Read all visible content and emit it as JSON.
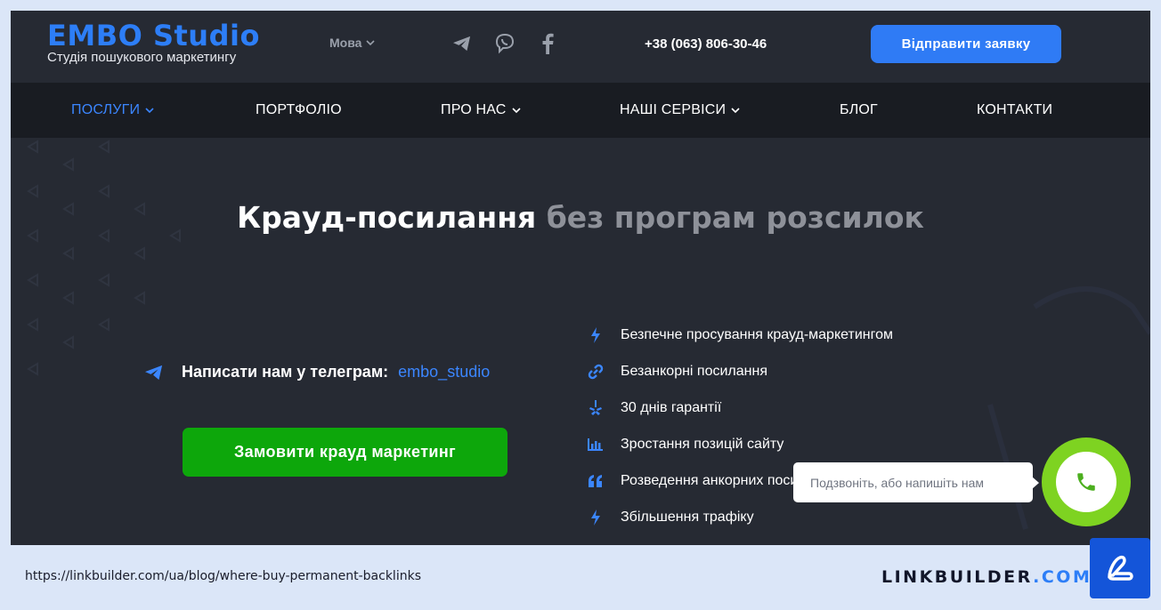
{
  "header": {
    "logo_title": "EMBO Studio",
    "logo_subtitle": "Студія пошукового маркетингу",
    "language_label": "Мова",
    "social_icons": [
      "telegram-icon",
      "viber-icon",
      "facebook-icon"
    ],
    "phone": "+38 (063) 806-30-46",
    "cta_label": "Відправити заявку"
  },
  "nav": {
    "items": [
      {
        "label": "ПОСЛУГИ",
        "has_dropdown": true,
        "active": true
      },
      {
        "label": "ПОРТФОЛІО",
        "has_dropdown": false
      },
      {
        "label": "ПРО НАС",
        "has_dropdown": true
      },
      {
        "label": "НАШІ СЕРВІСИ",
        "has_dropdown": true
      },
      {
        "label": "БЛОГ",
        "has_dropdown": false
      },
      {
        "label": "КОНТАКТИ",
        "has_dropdown": false
      }
    ]
  },
  "hero": {
    "headline_main": "Крауд-посилання",
    "headline_muted": "без програм розсилок",
    "telegram_prompt": "Написати нам у телеграм:",
    "telegram_handle": "embo_studio",
    "order_button": "Замовити крауд маркетинг",
    "features": [
      {
        "icon": "bolt-icon",
        "text": "Безпечне просування крауд-маркетингом"
      },
      {
        "icon": "link-icon",
        "text": "Безанкорні посилання"
      },
      {
        "icon": "yelp-icon",
        "text": "30 днів гарантії"
      },
      {
        "icon": "bar-chart-icon",
        "text": "Зростання позицій сайту"
      },
      {
        "icon": "quote-icon",
        "text": "Розведення анкорних посилань"
      },
      {
        "icon": "bolt-icon",
        "text": "Збільшення трафіку"
      }
    ]
  },
  "callback": {
    "bubble_text": "Подзвоніть, або напишіть нам"
  },
  "footer": {
    "url": "https://linkbuilder.com/ua/blog/where-buy-permanent-backlinks",
    "brand_name": "LINKBUILDER",
    "brand_tld": ".COM"
  },
  "colors": {
    "accent_blue": "#2f7bf5",
    "order_green": "#0da70b",
    "call_green": "#7ed321",
    "header_bg": "#262a33",
    "nav_bg": "#191c22"
  }
}
